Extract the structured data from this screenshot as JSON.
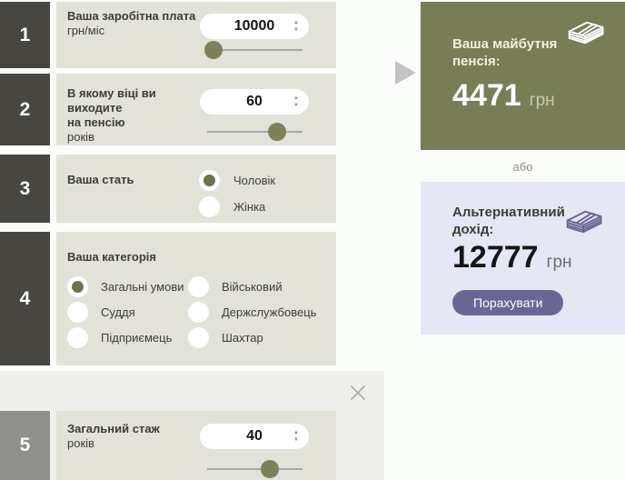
{
  "steps": [
    {
      "number": "1",
      "title": "Ваша заробітна плата",
      "subtitle": "грн/міс",
      "value": "10000",
      "slider_percent": 7
    },
    {
      "number": "2",
      "title": "В якому віці ви виходите",
      "title2": "на пенсію",
      "subtitle": "років",
      "value": "60",
      "slider_percent": 73
    },
    {
      "number": "3",
      "title": "Ваша стать",
      "radios": [
        {
          "label": "Чоловік",
          "selected": true
        },
        {
          "label": "Жінка",
          "selected": false
        }
      ]
    },
    {
      "number": "4",
      "title": "Ваша категорія",
      "radios": [
        {
          "label": "Загальні умови",
          "selected": true
        },
        {
          "label": "Військовий",
          "selected": false
        },
        {
          "label": "Суддя",
          "selected": false
        },
        {
          "label": "Держслужбовець",
          "selected": false
        },
        {
          "label": "Підприємець",
          "selected": false
        },
        {
          "label": "Шахтар",
          "selected": false
        }
      ]
    },
    {
      "number": "5",
      "title": "Загальний стаж",
      "subtitle": "років",
      "value": "40",
      "slider_percent": 66
    }
  ],
  "results": {
    "pension": {
      "title": "Ваша майбутня пенсія:",
      "value": "4471",
      "unit": "грн"
    },
    "or_text": "або",
    "alternative": {
      "title": "Альтернативний дохід:",
      "value": "12777",
      "unit": "грн",
      "button_label": "Порахувати"
    }
  },
  "icons": {
    "spinner_up": "▲",
    "spinner_down": "▼",
    "money": "banknotes-stack-icon",
    "close": "close-icon",
    "arrow": "arrow-right-icon"
  },
  "colors": {
    "page": "#fbfdfa",
    "beige": "#e2e2d9",
    "dark-box": "#474641",
    "gray-box": "#8f8f8c",
    "overlay": "#efefec",
    "olive": "#787d58",
    "cream": "#f3efdb",
    "olive-unit": "#c7c9ae",
    "lavender": "#e5e7f4",
    "purple": "#6a6694",
    "knob": "#7d815b",
    "radio-dot": "#6d714c",
    "track": "#a8a8a4",
    "text": "#3d3c37"
  }
}
